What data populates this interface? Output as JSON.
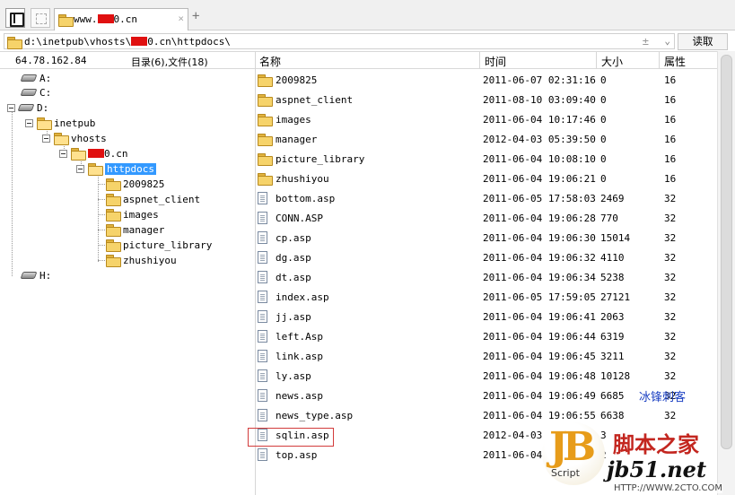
{
  "tab": {
    "title_prefix": "www.",
    "title_suffix": "0.cn",
    "close": "×",
    "new_tab": "+"
  },
  "address": {
    "path_prefix": "d:\\inetpub\\vhosts\\",
    "path_suffix": "0.cn\\httpdocs\\",
    "plus": "±",
    "dropdown": "⌄",
    "read_button": "读取"
  },
  "left_header": {
    "ip": "64.78.162.84",
    "summary": "目录(6),文件(18)"
  },
  "columns": {
    "name": "名称",
    "time": "时间",
    "size": "大小",
    "attr": "属性"
  },
  "tree": {
    "drives": [
      "A:",
      "C:",
      "D:",
      "H:"
    ],
    "inetpub": "inetpub",
    "vhosts": "vhosts",
    "site_suffix": "0.cn",
    "httpdocs": "httpdocs",
    "children": [
      "2009825",
      "aspnet_client",
      "images",
      "manager",
      "picture_library",
      "zhushiyou"
    ]
  },
  "files": [
    {
      "name": "2009825",
      "type": "folder",
      "time": "2011-06-07 02:31:16",
      "size": "0",
      "attr": "16"
    },
    {
      "name": "aspnet_client",
      "type": "folder",
      "time": "2011-08-10 03:09:40",
      "size": "0",
      "attr": "16"
    },
    {
      "name": "images",
      "type": "folder",
      "time": "2011-06-04 10:17:46",
      "size": "0",
      "attr": "16"
    },
    {
      "name": "manager",
      "type": "folder",
      "time": "2012-04-03 05:39:50",
      "size": "0",
      "attr": "16"
    },
    {
      "name": "picture_library",
      "type": "folder",
      "time": "2011-06-04 10:08:10",
      "size": "0",
      "attr": "16"
    },
    {
      "name": "zhushiyou",
      "type": "folder",
      "time": "2011-06-04 19:06:21",
      "size": "0",
      "attr": "16"
    },
    {
      "name": "bottom.asp",
      "type": "file",
      "time": "2011-06-05 17:58:03",
      "size": "2469",
      "attr": "32"
    },
    {
      "name": "CONN.ASP",
      "type": "file",
      "time": "2011-06-04 19:06:28",
      "size": "770",
      "attr": "32"
    },
    {
      "name": "cp.asp",
      "type": "file",
      "time": "2011-06-04 19:06:30",
      "size": "15014",
      "attr": "32"
    },
    {
      "name": "dg.asp",
      "type": "file",
      "time": "2011-06-04 19:06:32",
      "size": "4110",
      "attr": "32"
    },
    {
      "name": "dt.asp",
      "type": "file",
      "time": "2011-06-04 19:06:34",
      "size": "5238",
      "attr": "32"
    },
    {
      "name": "index.asp",
      "type": "file",
      "time": "2011-06-05 17:59:05",
      "size": "27121",
      "attr": "32"
    },
    {
      "name": "jj.asp",
      "type": "file",
      "time": "2011-06-04 19:06:41",
      "size": "2063",
      "attr": "32"
    },
    {
      "name": "left.Asp",
      "type": "file",
      "time": "2011-06-04 19:06:44",
      "size": "6319",
      "attr": "32"
    },
    {
      "name": "link.asp",
      "type": "file",
      "time": "2011-06-04 19:06:45",
      "size": "3211",
      "attr": "32"
    },
    {
      "name": "ly.asp",
      "type": "file",
      "time": "2011-06-04 19:06:48",
      "size": "10128",
      "attr": "32"
    },
    {
      "name": "news.asp",
      "type": "file",
      "time": "2011-06-04 19:06:49",
      "size": "6685",
      "attr": "32"
    },
    {
      "name": "news_type.asp",
      "type": "file",
      "time": "2011-06-04 19:06:55",
      "size": "6638",
      "attr": "32"
    },
    {
      "name": "sqlin.asp",
      "type": "file",
      "time": "2012-04-03",
      "size": "3",
      "attr": ""
    },
    {
      "name": "top.asp",
      "type": "file",
      "time": "2011-06-04",
      "size": "2",
      "attr": ""
    }
  ],
  "watermark": {
    "blog": "冰锋刺客",
    "logo": "JB",
    "logo_sub": "Script",
    "cn": "脚本之家",
    "site": "jb51.net",
    "url": "HTTP://WWW.2CTO.COM"
  },
  "colors": {
    "selection": "#3399ff",
    "mask_red": "#e01010",
    "highlight_box": "#d23b3b"
  }
}
